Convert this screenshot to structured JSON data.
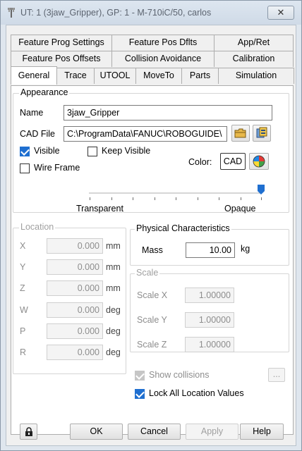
{
  "window": {
    "title": "UT: 1  (3jaw_Gripper), GP: 1 - M-710iC/50, carlos",
    "close_glyph": "✕"
  },
  "tabs": {
    "row1": [
      "Feature Prog Settings",
      "Feature Pos Dflts",
      "App/Ret"
    ],
    "row2": [
      "Feature Pos Offsets",
      "Collision Avoidance",
      "Calibration"
    ],
    "row3": [
      "General",
      "Trace",
      "UTOOL",
      "MoveTo",
      "Parts",
      "Simulation"
    ],
    "active": "General"
  },
  "appearance": {
    "legend": "Appearance",
    "name_label": "Name",
    "name_value": "3jaw_Gripper",
    "cad_label": "CAD File",
    "cad_value": "C:\\ProgramData\\FANUC\\ROBOGUIDE\\",
    "visible_label": "Visible",
    "visible_checked": true,
    "keep_visible_label": "Keep Visible",
    "keep_visible_checked": false,
    "wire_frame_label": "Wire Frame",
    "wire_frame_checked": false,
    "color_label": "Color:",
    "cad_button_label": "CAD",
    "transparent_label": "Transparent",
    "opaque_label": "Opaque",
    "opacity_value": 1.0
  },
  "location": {
    "legend": "Location",
    "rows": [
      {
        "label": "X",
        "value": "0.000",
        "unit": "mm"
      },
      {
        "label": "Y",
        "value": "0.000",
        "unit": "mm"
      },
      {
        "label": "Z",
        "value": "0.000",
        "unit": "mm"
      },
      {
        "label": "W",
        "value": "0.000",
        "unit": "deg"
      },
      {
        "label": "P",
        "value": "0.000",
        "unit": "deg"
      },
      {
        "label": "R",
        "value": "0.000",
        "unit": "deg"
      }
    ]
  },
  "physical": {
    "legend": "Physical Characteristics",
    "mass_label": "Mass",
    "mass_value": "10.00",
    "mass_unit": "kg"
  },
  "scale": {
    "legend": "Scale",
    "rows": [
      {
        "label": "Scale X",
        "value": "1.00000"
      },
      {
        "label": "Scale Y",
        "value": "1.00000"
      },
      {
        "label": "Scale Z",
        "value": "1.00000"
      }
    ]
  },
  "options": {
    "show_collisions_label": "Show collisions",
    "show_collisions_checked": true,
    "more_button_label": "...",
    "lock_location_label": "Lock All Location Values",
    "lock_location_checked": true
  },
  "buttons": {
    "ok": "OK",
    "cancel": "Cancel",
    "apply": "Apply",
    "help": "Help"
  },
  "colors": {
    "accent": "#1f6fd0",
    "disabled_text": "#8d8d8d"
  }
}
